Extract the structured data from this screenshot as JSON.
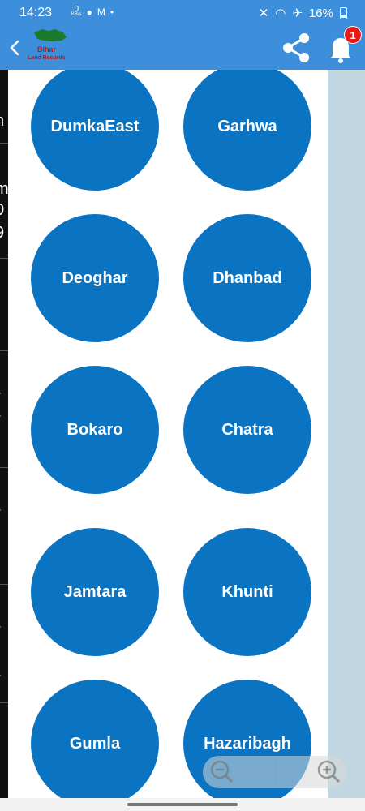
{
  "status_bar": {
    "time": "14:23",
    "data_rate": "0",
    "data_rate_unit": "KB/s",
    "battery": "16%"
  },
  "app_bar": {
    "logo_title": "Bihar",
    "logo_subtitle": "Land Records",
    "notification_count": "1"
  },
  "districts": [
    "DumkaEast",
    "Garhwa",
    "Deoghar",
    "Dhanbad",
    "Bokaro",
    "Chatra",
    "Jamtara",
    "Khunti",
    "Gumla",
    "Hazaribagh"
  ],
  "colors": {
    "header": "#3d8fdc",
    "district_button": "#0b74c2",
    "side_panel": "#c0d7e2",
    "badge": "#e41b17"
  },
  "icons": {
    "back": "back-arrow-icon",
    "share": "share-icon",
    "notifications": "bell-icon",
    "zoom_out": "zoom-out-icon",
    "zoom_in": "zoom-in-icon"
  }
}
